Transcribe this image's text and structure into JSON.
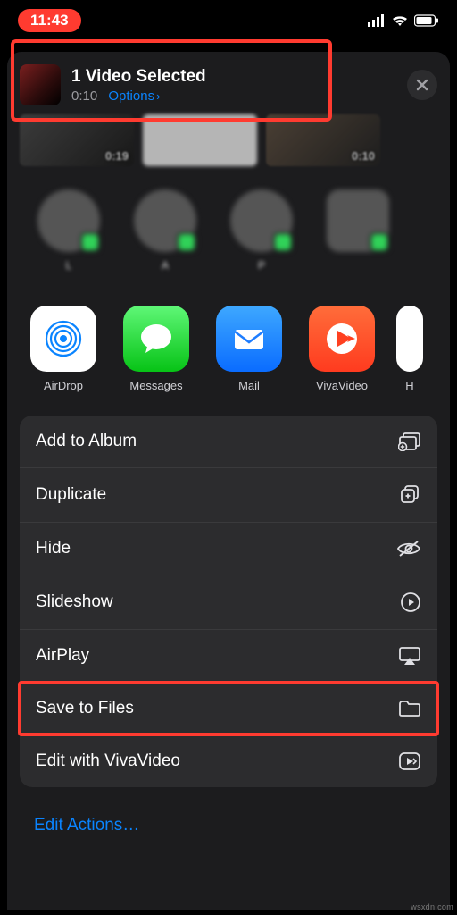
{
  "status": {
    "time": "11:43"
  },
  "header": {
    "title": "1 Video Selected",
    "duration": "0:10",
    "options_label": "Options"
  },
  "thumbs": [
    {
      "duration": "0:19"
    },
    {
      "duration": ""
    },
    {
      "duration": "0:10"
    }
  ],
  "contacts": [
    {
      "name": "L"
    },
    {
      "name": "A"
    },
    {
      "name": "P"
    },
    {
      "name": " "
    }
  ],
  "apps": {
    "airdrop": "AirDrop",
    "messages": "Messages",
    "mail": "Mail",
    "vivavideo": "VivaVideo",
    "extra": "H"
  },
  "actions": {
    "add_album": "Add to Album",
    "duplicate": "Duplicate",
    "hide": "Hide",
    "slideshow": "Slideshow",
    "airplay": "AirPlay",
    "save_files": "Save to Files",
    "edit_viva": "Edit with VivaVideo"
  },
  "edit_actions": "Edit Actions…",
  "watermark": "wsxdn.com"
}
